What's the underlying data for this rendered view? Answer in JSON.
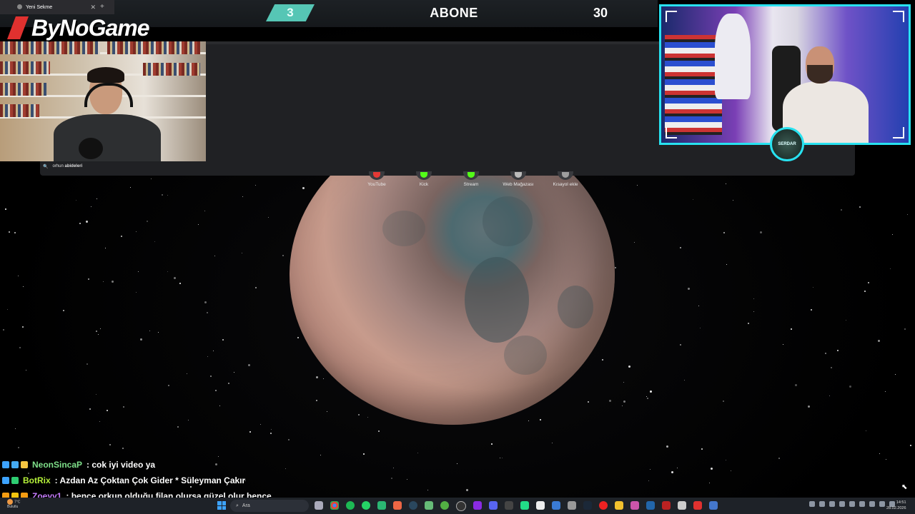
{
  "browser": {
    "tab_title": "Yeni Sekme",
    "tab_close": "✕",
    "new_tab": "+"
  },
  "overlay": {
    "logo_text": "ByNoGame",
    "left_counter": "3",
    "center_label": "ABONE",
    "right_counter": "30",
    "badge_text": "SERDAR"
  },
  "search": {
    "query_prefix": "orhun",
    "query_suffix": "abideleri"
  },
  "shortcuts": [
    {
      "label": "YouTube",
      "color": "#e53935"
    },
    {
      "label": "Kick",
      "color": "#53fc18"
    },
    {
      "label": "Stream",
      "color": "#53fc18"
    },
    {
      "label": "Web Mağazası",
      "color": "#bbbbbb"
    },
    {
      "label": "Kısayol ekle",
      "color": "#9e9e9e"
    }
  ],
  "chat": [
    {
      "user": "NeonSincaP",
      "user_color": "#7fe08a",
      "message": ": cok iyi video ya"
    },
    {
      "user": "BotRix",
      "user_color": "#b6f23a",
      "message": ": Azdan Az Çoktan Çok Gider * Süleyman Çakır"
    },
    {
      "user": "Zoeyy1",
      "user_color": "#c77dff",
      "message": ": bence orkun olduğu filan olursa güzel olur bence"
    }
  ],
  "taskbar": {
    "weather_temp": "7°C",
    "weather_desc": "Bulutlu",
    "search_placeholder": "Ara",
    "time": "14:51",
    "date": "28.02.2026"
  },
  "colors": {
    "accent_cyan": "#28e2f0",
    "counter_teal": "#56c6b5",
    "logo_red": "#e0312f"
  }
}
